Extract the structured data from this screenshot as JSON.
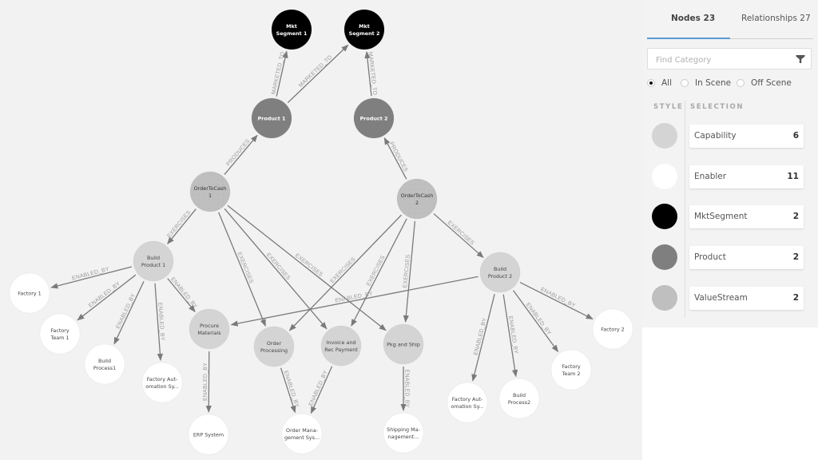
{
  "colors": {
    "Capability": "#d4d4d4",
    "Enabler": "#ffffff",
    "MktSegment": "#000000",
    "Product": "#7f7f7f",
    "ValueStream": "#bfbfbf",
    "accent": "#5b9bd5"
  },
  "panel": {
    "tabs": [
      {
        "label": "Nodes 23",
        "active": true
      },
      {
        "label": "Relationships 27",
        "active": false
      }
    ],
    "search": {
      "placeholder": "Find Category",
      "value": ""
    },
    "filters": [
      {
        "label": "All",
        "checked": true
      },
      {
        "label": "In Scene",
        "checked": false
      },
      {
        "label": "Off Scene",
        "checked": false
      }
    ],
    "headers": {
      "style": "STYLE",
      "selection": "SELECTION"
    },
    "categories": [
      {
        "name": "Capability",
        "count": "6"
      },
      {
        "name": "Enabler",
        "count": "11"
      },
      {
        "name": "MktSegment",
        "count": "2"
      },
      {
        "name": "Product",
        "count": "2"
      },
      {
        "name": "ValueStream",
        "count": "2"
      }
    ]
  },
  "graph": {
    "nodes": [
      {
        "id": "ms1",
        "label": [
          "Mkt",
          "Segment 1"
        ],
        "type": "MktSegment"
      },
      {
        "id": "ms2",
        "label": [
          "Mkt",
          "Segment 2"
        ],
        "type": "MktSegment"
      },
      {
        "id": "p1",
        "label": [
          "Product 1"
        ],
        "type": "Product"
      },
      {
        "id": "p2",
        "label": [
          "Product 2"
        ],
        "type": "Product"
      },
      {
        "id": "otc1",
        "label": [
          "OrderToCash",
          "1"
        ],
        "type": "ValueStream"
      },
      {
        "id": "otc2",
        "label": [
          "OrderToCash",
          "2"
        ],
        "type": "ValueStream"
      },
      {
        "id": "bp1",
        "label": [
          "Build",
          "Product 1"
        ],
        "type": "Capability"
      },
      {
        "id": "bp2",
        "label": [
          "Build",
          "Product 2"
        ],
        "type": "Capability"
      },
      {
        "id": "pm",
        "label": [
          "Procure",
          "Materials"
        ],
        "type": "Capability"
      },
      {
        "id": "op",
        "label": [
          "Order",
          "Processing"
        ],
        "type": "Capability"
      },
      {
        "id": "irp",
        "label": [
          "Invoice and",
          "Rec Payment"
        ],
        "type": "Capability"
      },
      {
        "id": "pks",
        "label": [
          "Pkg and Ship"
        ],
        "type": "Capability"
      },
      {
        "id": "f1",
        "label": [
          "Factory 1"
        ],
        "type": "Enabler"
      },
      {
        "id": "ft1",
        "label": [
          "Factory",
          "Team 1"
        ],
        "type": "Enabler"
      },
      {
        "id": "bpr1",
        "label": [
          "Build",
          "Process1"
        ],
        "type": "Enabler"
      },
      {
        "id": "fa1",
        "label": [
          "Factory Aut-",
          "omation Sy..."
        ],
        "type": "Enabler"
      },
      {
        "id": "erp",
        "label": [
          "ERP System"
        ],
        "type": "Enabler"
      },
      {
        "id": "oms",
        "label": [
          "Order Mana-",
          "gement Sys..."
        ],
        "type": "Enabler"
      },
      {
        "id": "sms",
        "label": [
          "Shipping Ma-",
          "nagement..."
        ],
        "type": "Enabler"
      },
      {
        "id": "fa2",
        "label": [
          "Factory Aut-",
          "omation Sy..."
        ],
        "type": "Enabler"
      },
      {
        "id": "bpr2",
        "label": [
          "Build",
          "Process2"
        ],
        "type": "Enabler"
      },
      {
        "id": "ft2",
        "label": [
          "Factory",
          "Team 2"
        ],
        "type": "Enabler"
      },
      {
        "id": "f2",
        "label": [
          "Factory 2"
        ],
        "type": "Enabler"
      }
    ],
    "edges": [
      {
        "from": "p1",
        "to": "ms1",
        "label": "MARKETED_TO"
      },
      {
        "from": "p1",
        "to": "ms2",
        "label": "MARKETED_TO"
      },
      {
        "from": "p2",
        "to": "ms2",
        "label": "MARKETED_TO"
      },
      {
        "from": "otc1",
        "to": "p1",
        "label": "PRODUCES"
      },
      {
        "from": "otc2",
        "to": "p2",
        "label": "PRODUCES"
      },
      {
        "from": "otc1",
        "to": "bp1",
        "label": "EXERCISES"
      },
      {
        "from": "otc1",
        "to": "op",
        "label": "EXERCISES"
      },
      {
        "from": "otc1",
        "to": "irp",
        "label": "EXERCISES"
      },
      {
        "from": "otc1",
        "to": "pks",
        "label": "EXERCISES"
      },
      {
        "from": "otc2",
        "to": "op",
        "label": "EXERCISES"
      },
      {
        "from": "otc2",
        "to": "irp",
        "label": "EXERCISES"
      },
      {
        "from": "otc2",
        "to": "pks",
        "label": "EXERCISES"
      },
      {
        "from": "otc2",
        "to": "bp2",
        "label": "EXERCISES"
      },
      {
        "from": "bp1",
        "to": "f1",
        "label": "ENABLED_BY"
      },
      {
        "from": "bp1",
        "to": "ft1",
        "label": "ENABLED_BY"
      },
      {
        "from": "bp1",
        "to": "bpr1",
        "label": "ENABLED_BY"
      },
      {
        "from": "bp1",
        "to": "fa1",
        "label": "ENABLED_BY"
      },
      {
        "from": "bp1",
        "to": "pm",
        "label": "ENABLED_BY"
      },
      {
        "from": "bp2",
        "to": "pm",
        "label": "ENABLED_BY"
      },
      {
        "from": "bp2",
        "to": "fa2",
        "label": "ENABLED_BY"
      },
      {
        "from": "bp2",
        "to": "bpr2",
        "label": "ENABLED_BY"
      },
      {
        "from": "bp2",
        "to": "ft2",
        "label": "ENABLED_BY"
      },
      {
        "from": "bp2",
        "to": "f2",
        "label": "ENABLED_BY"
      },
      {
        "from": "pm",
        "to": "erp",
        "label": "ENABLED_BY"
      },
      {
        "from": "op",
        "to": "oms",
        "label": "ENABLED_BY"
      },
      {
        "from": "irp",
        "to": "oms",
        "label": "ENABLED_BY"
      },
      {
        "from": "pks",
        "to": "sms",
        "label": "ENABLED_BY"
      }
    ]
  }
}
